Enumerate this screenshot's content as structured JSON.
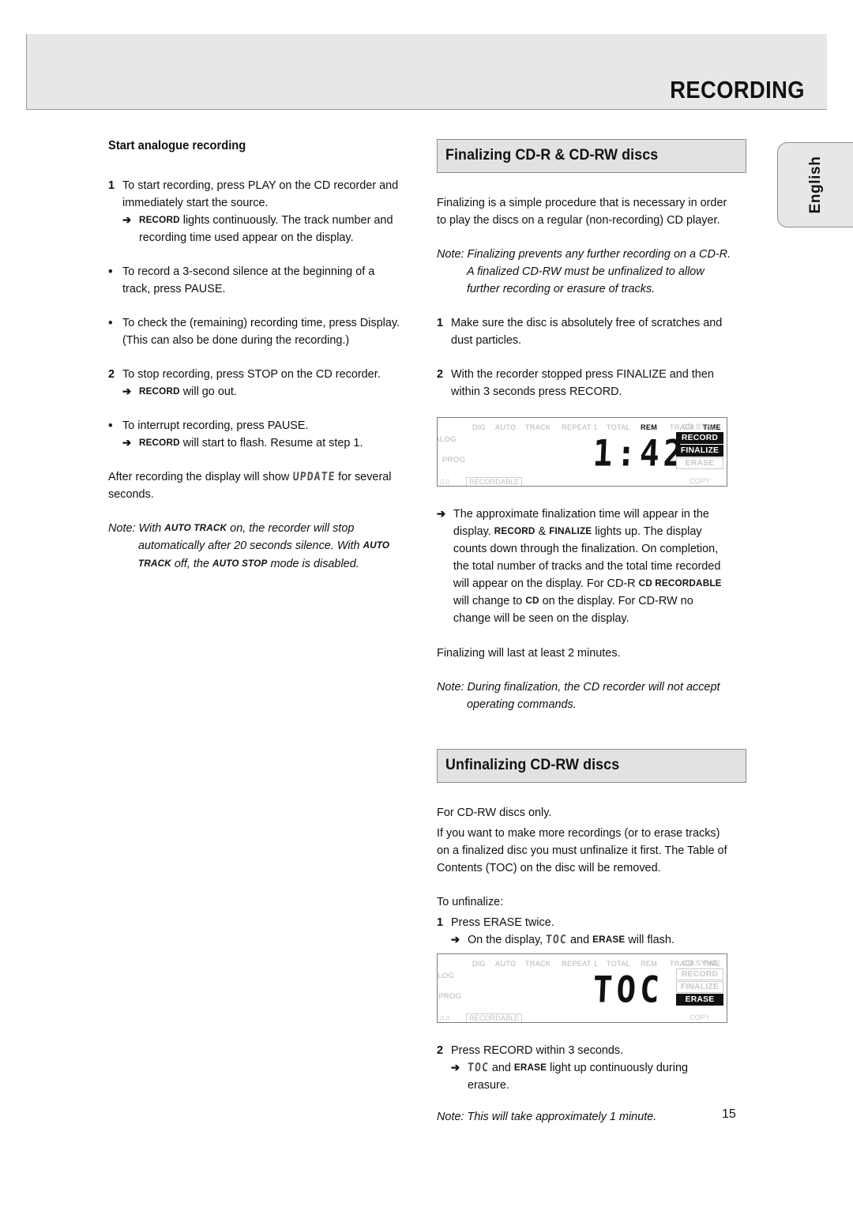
{
  "header": {
    "title": "RECORDING"
  },
  "language_tab": {
    "label": "English"
  },
  "page_number": "15",
  "left_column": {
    "heading": "Start analogue recording",
    "step1": {
      "marker": "1",
      "text": "To start recording, press PLAY on the CD recorder and immediately start the source.",
      "result_prefix": "RECORD",
      "result_text": " lights continuously. The track number and recording time used appear on the display."
    },
    "bullet1": {
      "marker": "•",
      "text": "To record a 3-second silence at the beginning of a track, press PAUSE."
    },
    "bullet2": {
      "marker": "•",
      "text": "To check the (remaining) recording time, press Display. (This can also be done during the recording.)"
    },
    "step2": {
      "marker": "2",
      "text": "To stop recording, press STOP on the CD recorder.",
      "result_prefix": "RECORD",
      "result_text": " will go out."
    },
    "bullet3": {
      "marker": "•",
      "text": "To interrupt recording, press PAUSE.",
      "result_prefix": "RECORD",
      "result_text": " will start to flash. Resume at step 1."
    },
    "after_recording": {
      "before": "After recording the display will show ",
      "lcd_word": "UPDATE",
      "after": " for several seconds."
    },
    "note": {
      "label": "Note:",
      "part1": " With ",
      "bold1": "AUTO TRACK",
      "part2": " on, the recorder will stop automatically after 20 seconds silence. With ",
      "bold2": "AUTO TRACK",
      "part3": " off, the ",
      "bold3": "AUTO STOP",
      "part4": " mode is disabled."
    }
  },
  "right_column": {
    "section1": {
      "title": "Finalizing CD-R & CD-RW discs",
      "intro": "Finalizing is a simple procedure that is necessary in order to play the discs on a regular (non-recording) CD player.",
      "note": {
        "label": "Note:",
        "text": " Finalizing prevents any further recording on a CD-R. A finalized CD-RW must be unfinalized to allow further recording or erasure of tracks."
      },
      "step1": {
        "marker": "1",
        "text": "Make sure the disc is absolutely free of scratches and dust particles."
      },
      "step2": {
        "marker": "2",
        "text": "With the recorder stopped press FINALIZE and then within 3 seconds press RECORD."
      },
      "result": {
        "line1a": "The approximate finalization time will appear in the display. ",
        "bold1": "RECORD",
        "line1b": " & ",
        "bold2": "FINALIZE",
        "line1c": " lights up.",
        "line2": "The display counts down through the finalization. On completion, the total number of tracks and the total time recorded will appear on the display.",
        "line3a": "For CD-R ",
        "bold3": "CD RECORDABLE",
        "line3b": " will change to ",
        "bold4": "CD",
        "line3c": " on the display. For CD-RW no change will be seen on the display."
      },
      "duration": "Finalizing will last at least 2 minutes.",
      "note2": {
        "label": "Note:",
        "text": " During finalization, the CD recorder will not accept operating commands."
      }
    },
    "section2": {
      "title": "Unfinalizing CD-RW discs",
      "para1": "For CD-RW discs only.",
      "para2": "If you want to make more recordings (or to erase tracks) on a finalized disc you must unfinalize it first. The Table of Contents (TOC) on the disc will be removed.",
      "intro": "To unfinalize:",
      "step1": {
        "marker": "1",
        "text": "Press ERASE twice."
      },
      "step1_result": {
        "before": "On the display, ",
        "lcd_word": "TOC",
        "middle": " and ",
        "bold": "ERASE",
        "after": " will flash."
      },
      "step2": {
        "marker": "2",
        "text": "Press RECORD within 3 seconds."
      },
      "step2_result": {
        "lcd_word": "TOC",
        "middle": " and ",
        "bold": "ERASE",
        "after": " light up continuously during erasure."
      },
      "note": {
        "label": "Note:",
        "text": " This will take approximately 1 minute."
      }
    }
  },
  "displays": [
    {
      "id": "finalize-display",
      "top_labels": [
        {
          "text": "DIG",
          "active": false
        },
        {
          "text": "AUTO",
          "active": false
        },
        {
          "text": "TRACK",
          "active": false
        },
        {
          "text": "REPEAT 1",
          "active": false
        },
        {
          "text": "TOTAL",
          "active": false
        },
        {
          "text": "REM",
          "active": true
        },
        {
          "text": "TRACK",
          "active": false
        },
        {
          "text": "TIME",
          "active": true
        }
      ],
      "side_left_top": "ALOG",
      "side_left_bottom": "PROG",
      "digits": "1:42",
      "cd_sync_label": "CD SYNC",
      "indicators": [
        {
          "text": "RECORD",
          "active": true
        },
        {
          "text": "FINALIZE",
          "active": true
        },
        {
          "text": "ERASE",
          "active": false
        }
      ],
      "bottom_recordable": "RECORDABLE",
      "bottom_copy": "COPY"
    },
    {
      "id": "toc-display",
      "top_labels": [
        {
          "text": "DIG",
          "active": false
        },
        {
          "text": "AUTO",
          "active": false
        },
        {
          "text": "TRACK",
          "active": false
        },
        {
          "text": "REPEAT 1",
          "active": false
        },
        {
          "text": "TOTAL",
          "active": false
        },
        {
          "text": "REM",
          "active": false
        },
        {
          "text": "TRACK",
          "active": false
        },
        {
          "text": "TIME",
          "active": false
        }
      ],
      "side_left_top": "LOG",
      "side_left_bottom": "PROG",
      "digits": "TOC",
      "cd_sync_label": "CD SYNC",
      "indicators": [
        {
          "text": "RECORD",
          "active": false
        },
        {
          "text": "FINALIZE",
          "active": false
        },
        {
          "text": "ERASE",
          "active": true
        }
      ],
      "bottom_recordable": "RECORDABLE",
      "bottom_copy": "COPY"
    }
  ]
}
